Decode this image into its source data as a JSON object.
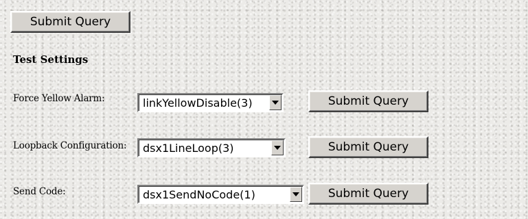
{
  "top": {
    "submit_label": "Submit Query"
  },
  "section": {
    "heading": "Test Settings"
  },
  "rows": [
    {
      "label": "Force Yellow Alarm:",
      "selected": "linkYellowDisable(3)",
      "submit_label": "Submit Query"
    },
    {
      "label": "Loopback Configuration:",
      "selected": "dsx1LineLoop(3)",
      "submit_label": "Submit Query"
    },
    {
      "label": "Send Code:",
      "selected": "dsx1SendNoCode(1)",
      "submit_label": "Submit Query"
    }
  ],
  "icons": {
    "dropdown": "chevron-down-icon"
  }
}
